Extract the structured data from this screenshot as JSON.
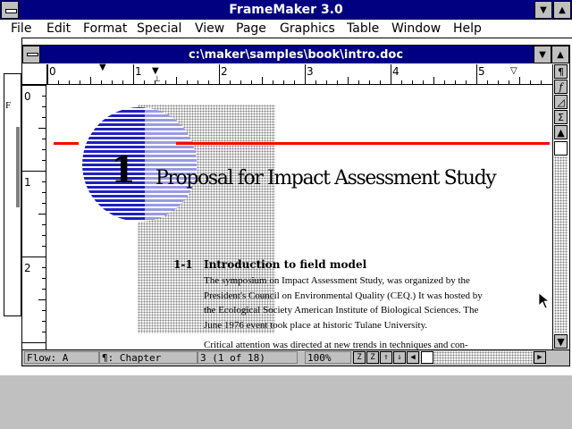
{
  "app": {
    "title": "FrameMaker 3.0",
    "menu": [
      {
        "label": "File"
      },
      {
        "label": "Edit"
      },
      {
        "label": "Format"
      },
      {
        "label": "Special"
      },
      {
        "label": "View"
      },
      {
        "label": "Page"
      },
      {
        "label": "Graphics"
      },
      {
        "label": "Table"
      },
      {
        "label": "Window"
      },
      {
        "label": "Help"
      }
    ]
  },
  "document": {
    "title": "c:\\maker\\samples\\book\\intro.doc",
    "ruler_numbers": [
      "0",
      "1",
      "2",
      "3",
      "4",
      "5"
    ],
    "vertical_ruler_numbers": [
      "0",
      "1",
      "2"
    ],
    "chapter_number": "1",
    "chapter_title": "Proposal for Impact Assessment Study",
    "section_number": "1-1",
    "section_title": "Introduction to field model",
    "paragraph1_lines": [
      "The symposium on Impact Assessment Study, was organized by the",
      "President's Council on Environmental Quality (CEQ.) It was hosted by",
      "the Ecological Society American Institute of Biological Sciences. The",
      "June 1976 event took place at historic Tulane University."
    ],
    "paragraph2_partial": "Critical attention was directed at new trends in techniques and con-"
  },
  "status": {
    "flow": "Flow: A",
    "paragraph_tag": "¶: Chapter",
    "page": "3 (1 of 18)",
    "zoom": "100%"
  },
  "toolbar_icons": [
    "paragraph-icon",
    "function-icon",
    "triangle-icon",
    "sigma-icon",
    "up-arrow-icon"
  ],
  "colors": {
    "titlebar": "#000080",
    "rule_line": "#ff0000",
    "stripes": "#2020c0"
  }
}
